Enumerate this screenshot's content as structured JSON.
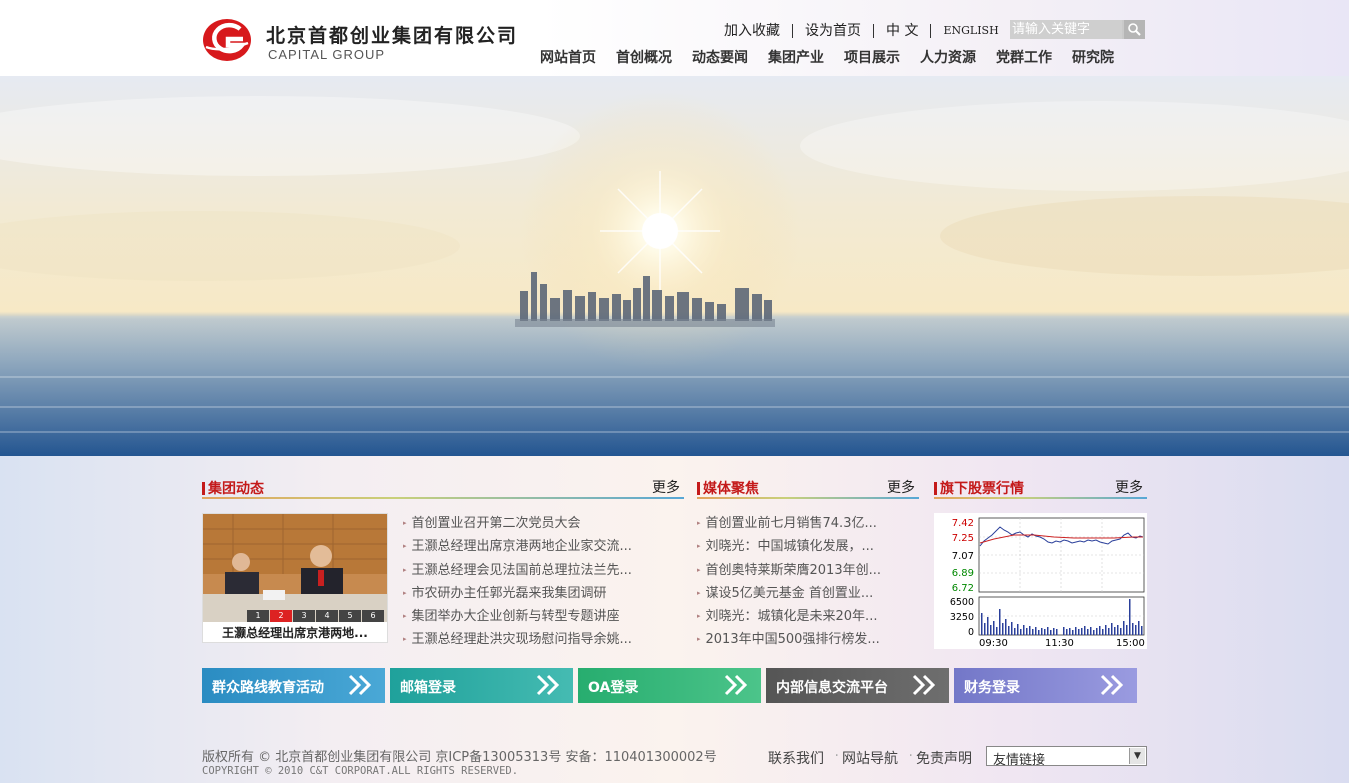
{
  "logo": {
    "cn": "北京首都创业集团有限公司",
    "en": "CAPITAL GROUP"
  },
  "toplinks": [
    "加入收藏",
    "设为首页",
    "中 文",
    "ENGLISH"
  ],
  "search": {
    "placeholder": "请输入关键字",
    "icon": "search-icon"
  },
  "nav": [
    "网站首页",
    "首创概况",
    "动态要闻",
    "集团产业",
    "项目展示",
    "人力资源",
    "党群工作",
    "研究院"
  ],
  "group_news": {
    "title": "集团动态",
    "more": "更多",
    "photo_caption": "王灏总经理出席京港两地...",
    "photo_pages": [
      "1",
      "2",
      "3",
      "4",
      "5",
      "6"
    ],
    "photo_active": "2",
    "items": [
      "首创置业召开第二次党员大会",
      "王灏总经理出席京港两地企业家交流...",
      "王灏总经理会见法国前总理拉法兰先...",
      "市农研办主任郭光磊来我集团调研",
      "集团举办大企业创新与转型专题讲座",
      "王灏总经理赴洪灾现场慰问指导余姚..."
    ]
  },
  "media": {
    "title": "媒体聚焦",
    "more": "更多",
    "items": [
      "首创置业前七月销售74.3亿...",
      "刘晓光：中国城镇化发展，...",
      "首创奥特莱斯荣膺2013年创...",
      "谋设5亿美元基金 首创置业...",
      "刘晓光：城镇化是未来20年...",
      "2013年中国500强排行榜发..."
    ]
  },
  "stock": {
    "title": "旗下股票行情",
    "more": "更多",
    "price_ticks": [
      "7.42",
      "7.25",
      "7.07",
      "6.89",
      "6.72"
    ],
    "volume_ticks": [
      "6500",
      "3250",
      "0"
    ],
    "time_ticks": [
      "09:30",
      "11:30",
      "15:00"
    ],
    "colors": {
      "up": "#cc0000",
      "down": "#008800",
      "flat": "#000000",
      "price_line": "#2a3f9a",
      "avg_line": "#cc2222"
    }
  },
  "quick_buttons": [
    {
      "label": "群众路线教育活动",
      "color": "#2f95c6"
    },
    {
      "label": "邮箱登录",
      "color": "#27a9a3"
    },
    {
      "label": "OA登录",
      "color": "#2fb57a"
    },
    {
      "label": "内部信息交流平台",
      "color": "#5e5e5e"
    },
    {
      "label": "财务登录",
      "color": "#7d82cf"
    }
  ],
  "footer": {
    "copyright": "版权所有 © 北京首都创业集团有限公司 京ICP备13005313号 安备：110401300002号",
    "copyright_en": "COPYRIGHT © 2010 C&T CORPORAT.ALL RIGHTS RESERVED.",
    "links": [
      "联系我们",
      "网站导航",
      "免责声明"
    ],
    "friend_links": "友情链接"
  }
}
